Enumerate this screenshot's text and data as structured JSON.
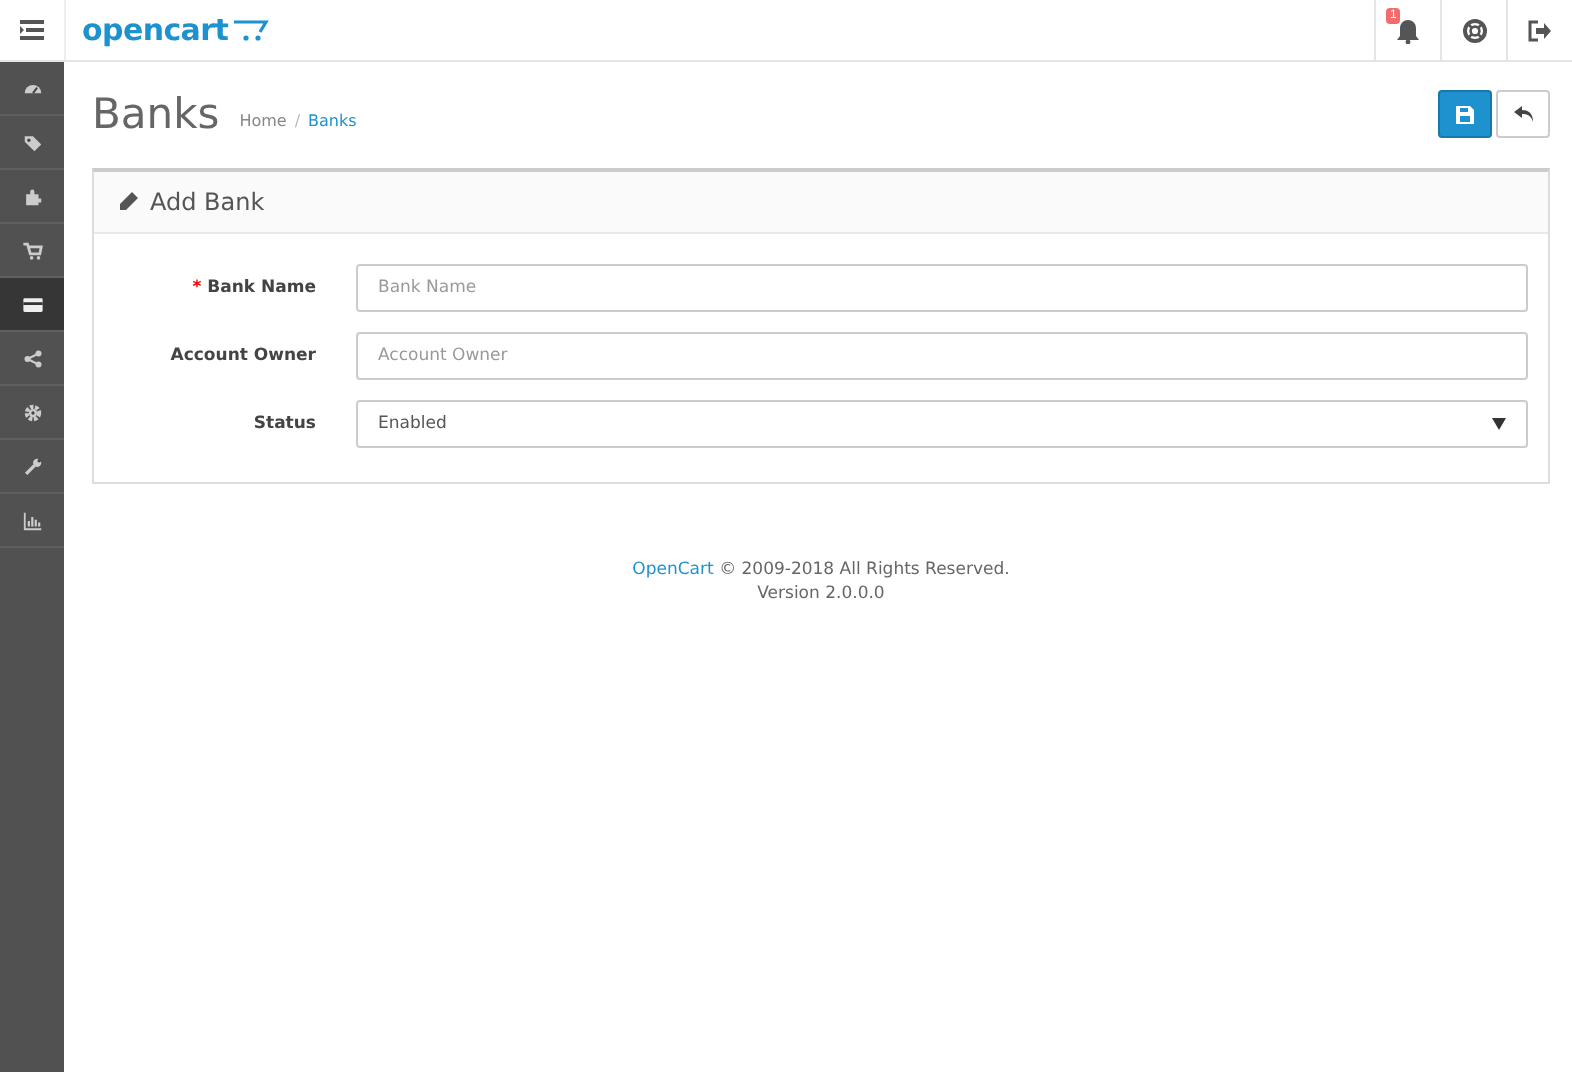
{
  "header": {
    "logo": "opencart",
    "notification_count": "1"
  },
  "sidebar": {
    "items": [
      {
        "kind": "dashboard",
        "selected": false
      },
      {
        "kind": "tags",
        "selected": false
      },
      {
        "kind": "puzzle",
        "selected": false
      },
      {
        "kind": "cart",
        "selected": false
      },
      {
        "kind": "card",
        "selected": true
      },
      {
        "kind": "share",
        "selected": false
      },
      {
        "kind": "gear",
        "selected": false
      },
      {
        "kind": "wrench",
        "selected": false
      },
      {
        "kind": "chart",
        "selected": false
      }
    ]
  },
  "page": {
    "title": "Banks",
    "breadcrumbs": [
      {
        "label": "Home",
        "link": false
      },
      {
        "label": "Banks",
        "link": true
      }
    ],
    "breadcrumb_separator": "/"
  },
  "panel": {
    "title": "Add Bank",
    "fields": [
      {
        "kind": "text",
        "label": "Bank Name",
        "required_mark": "*",
        "placeholder": "Bank Name"
      },
      {
        "kind": "text",
        "label": "Account Owner",
        "placeholder": "Account Owner"
      },
      {
        "kind": "select",
        "label": "Status",
        "value": "Enabled"
      }
    ]
  },
  "footer": {
    "link": "OpenCart",
    "text": "© 2009-2018 All Rights Reserved.",
    "version": "Version 2.0.0.0"
  }
}
